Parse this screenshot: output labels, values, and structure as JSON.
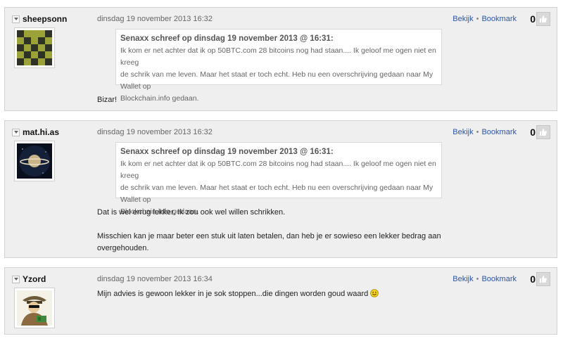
{
  "actions": {
    "view_label": "Bekijk",
    "bookmark_label": "Bookmark",
    "separator": "•"
  },
  "posts": [
    {
      "author": "sheepsonn",
      "date": "dinsdag 19 november 2013 16:32",
      "score": "0",
      "avatar_icon": "sheep-pixel-avatar",
      "quote": {
        "header": "Senaxx schreef op dinsdag 19 november 2013 @ 16:31:",
        "lines": [
          "Ik kom er net achter dat ik op 50BTC.com 28 bitcoins nog had staan.... Ik geloof me ogen niet en kreeg",
          "de schrik van me leven. Maar het staat er toch echt. Heb nu een overschrijving gedaan naar My Wallet op",
          "Blockchain.info gedaan."
        ]
      },
      "message": [
        "Bizar!"
      ]
    },
    {
      "author": "mat.hi.as",
      "date": "dinsdag 19 november 2013 16:32",
      "score": "0",
      "avatar_icon": "planet-avatar",
      "quote": {
        "header": "Senaxx schreef op dinsdag 19 november 2013 @ 16:31:",
        "lines": [
          "Ik kom er net achter dat ik op 50BTC.com 28 bitcoins nog had staan.... Ik geloof me ogen niet en kreeg",
          "de schrik van me leven. Maar het staat er toch echt. Heb nu een overschrijving gedaan naar My Wallet op",
          "Blockchain.info gedaan."
        ]
      },
      "message": [
        "Dat is wel errug lekker. Ik zou ook wel willen schrikken.",
        "",
        "Misschien kan je maar beter een stuk uit laten betalen, dan heb je er sowieso een lekker bedrag aan",
        "overgehouden."
      ]
    },
    {
      "author": "Yzord",
      "date": "dinsdag 19 november 2013 16:34",
      "score": "0",
      "avatar_icon": "spy-cartoon-avatar",
      "message": [
        "Mijn advies is gewoon lekker in je sok stoppen...die dingen worden goud waard"
      ],
      "message_emoji": "smiley-icon"
    }
  ]
}
